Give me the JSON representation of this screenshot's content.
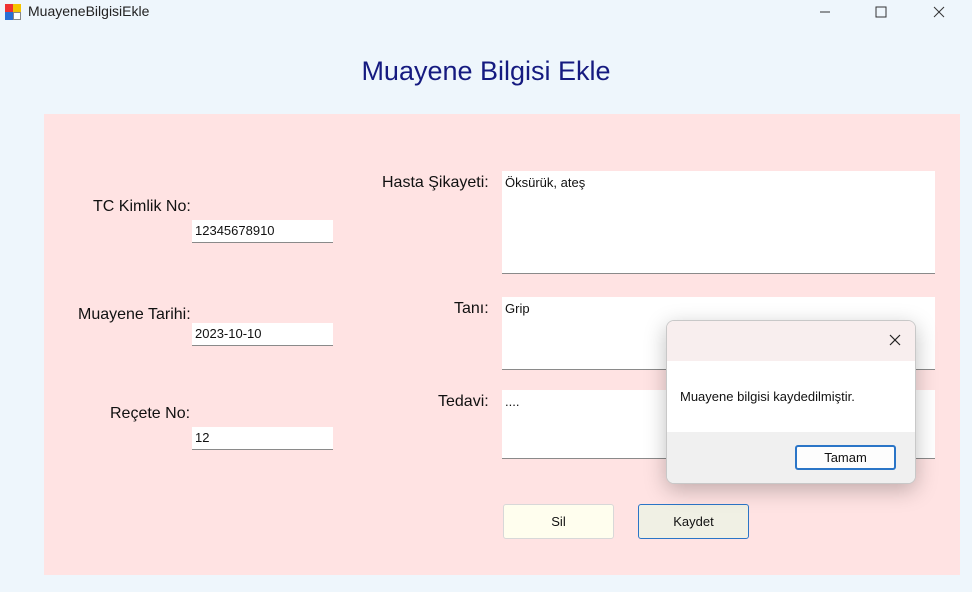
{
  "window": {
    "title": "MuayeneBilgisiEkle"
  },
  "form": {
    "heading": "Muayene Bilgisi Ekle",
    "tc_label": "TC Kimlik No:",
    "tc_value": "12345678910",
    "date_label": "Muayene Tarihi:",
    "date_value": "2023-10-10",
    "recete_label": "Reçete No:",
    "recete_value": "12",
    "sikayet_label": "Hasta Şikayeti:",
    "sikayet_value": "Öksürük, ateş",
    "tani_label": "Tanı:",
    "tani_value": "Grip",
    "tedavi_label": "Tedavi:",
    "tedavi_value": "....",
    "delete_label": "Sil",
    "save_label": "Kaydet"
  },
  "dialog": {
    "message": "Muayene bilgisi kaydedilmiştir.",
    "ok_label": "Tamam"
  },
  "colors": {
    "panel": "#ffe3e3",
    "heading": "#151a80",
    "accent": "#2b75c7"
  }
}
